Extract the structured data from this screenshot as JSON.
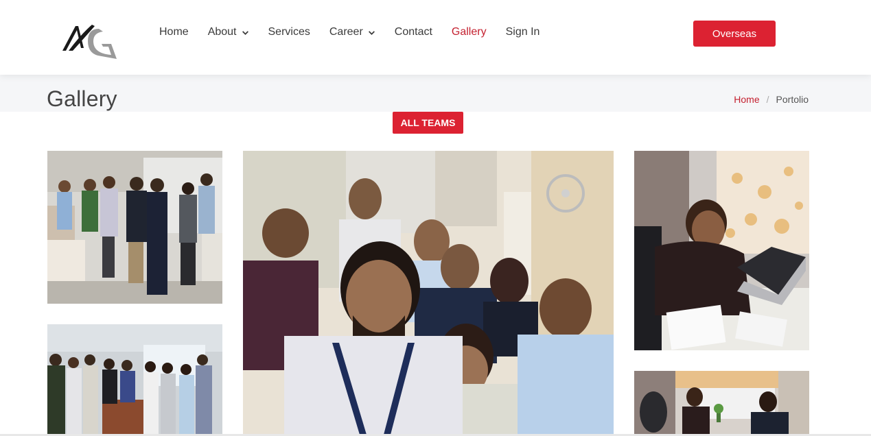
{
  "header": {
    "logo_icon": "ag-logo-icon",
    "nav": [
      {
        "label": "Home",
        "dropdown": false,
        "active": false
      },
      {
        "label": "About",
        "dropdown": true,
        "active": false
      },
      {
        "label": "Services",
        "dropdown": false,
        "active": false
      },
      {
        "label": "Career",
        "dropdown": true,
        "active": false
      },
      {
        "label": "Contact",
        "dropdown": false,
        "active": false
      },
      {
        "label": "Gallery",
        "dropdown": false,
        "active": true
      },
      {
        "label": "Sign In",
        "dropdown": false,
        "active": false
      }
    ],
    "cta_label": "Overseas"
  },
  "page": {
    "title": "Gallery",
    "breadcrumb": {
      "home": "Home",
      "separator": "/",
      "current": "Portolio"
    }
  },
  "filter": {
    "label": "ALL TEAMS"
  },
  "gallery": {
    "images": [
      {
        "name": "team-group-photo-office"
      },
      {
        "name": "team-selfie"
      },
      {
        "name": "man-working-on-laptop"
      },
      {
        "name": "team-group-photo-meeting"
      },
      {
        "name": "office-desk-meeting"
      }
    ]
  },
  "colors": {
    "accent": "#dc2232",
    "active_link": "#c4202f",
    "text": "#3a3a3a",
    "band": "#f5f6f8"
  }
}
